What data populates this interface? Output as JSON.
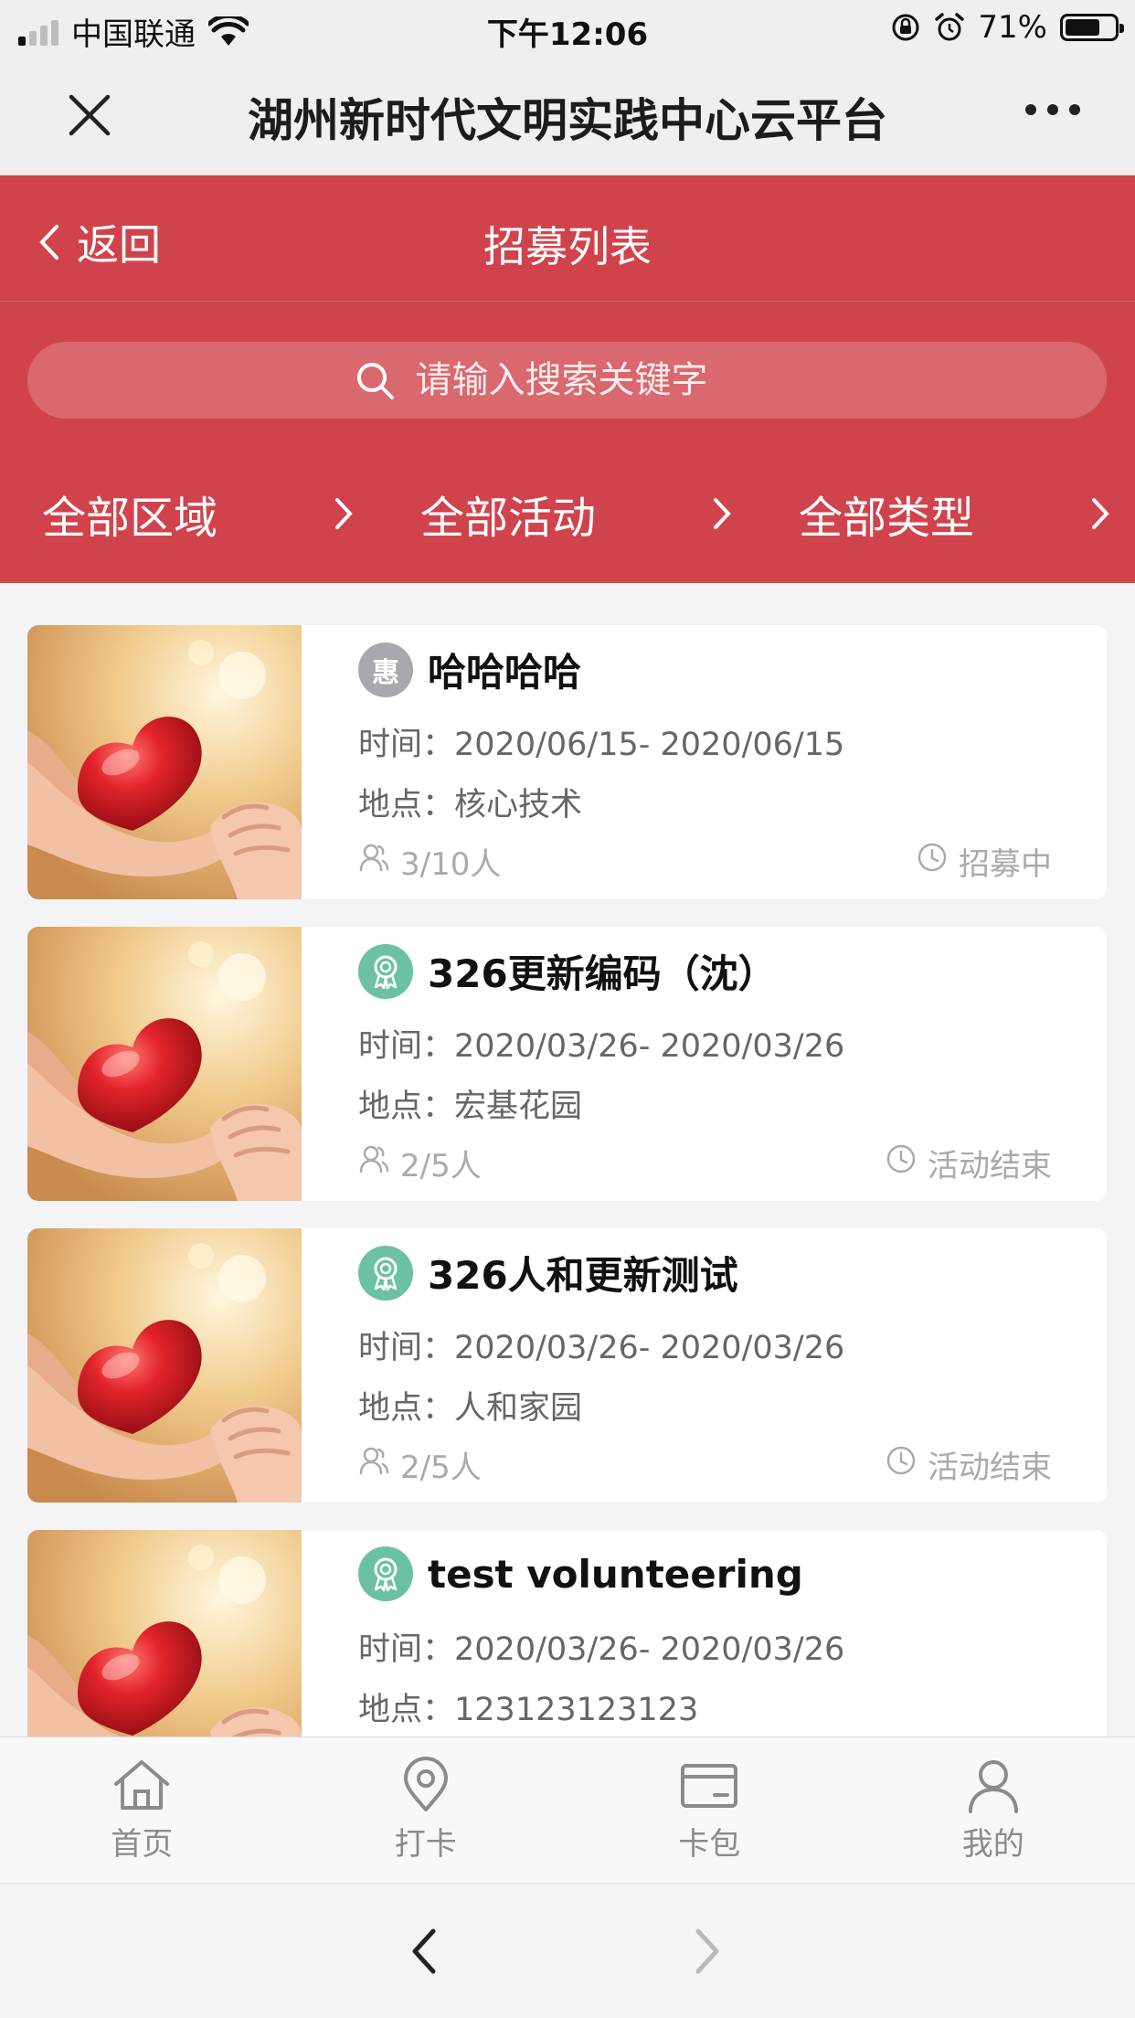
{
  "status_bar": {
    "carrier": "中国联通",
    "time": "下午12:06",
    "battery": "71%",
    "battery_level": 0.71
  },
  "title_bar": {
    "title": "湖州新时代文明实践中心云平台"
  },
  "header": {
    "back_label": "返回",
    "title": "招募列表"
  },
  "search": {
    "placeholder": "请输入搜索关键字"
  },
  "filters": [
    {
      "label": "全部区域"
    },
    {
      "label": "全部活动"
    },
    {
      "label": "全部类型"
    }
  ],
  "items": [
    {
      "badge": "惠",
      "badge_style": "gray",
      "title": "哈哈哈哈",
      "time_label": "时间：",
      "time": "2020/06/15- 2020/06/15",
      "place_label": "地点：",
      "place": "核心技术",
      "count": "3/10人",
      "status": "招募中"
    },
    {
      "badge": "",
      "badge_style": "green",
      "title": "326更新编码（沈）",
      "time_label": "时间：",
      "time": "2020/03/26- 2020/03/26",
      "place_label": "地点：",
      "place": "宏基花园",
      "count": "2/5人",
      "status": "活动结束"
    },
    {
      "badge": "",
      "badge_style": "green",
      "title": "326人和更新测试",
      "time_label": "时间：",
      "time": "2020/03/26- 2020/03/26",
      "place_label": "地点：",
      "place": "人和家园",
      "count": "2/5人",
      "status": "活动结束"
    },
    {
      "badge": "",
      "badge_style": "green",
      "title": "test volunteering",
      "time_label": "时间：",
      "time": "2020/03/26- 2020/03/26",
      "place_label": "地点：",
      "place": "123123123123",
      "count": "",
      "status": ""
    }
  ],
  "tabbar": [
    {
      "label": "首页",
      "icon": "home-icon"
    },
    {
      "label": "打卡",
      "icon": "location-pin-icon"
    },
    {
      "label": "卡包",
      "icon": "wallet-icon"
    },
    {
      "label": "我的",
      "icon": "user-icon"
    }
  ],
  "colors": {
    "brand_red": "#d1434c",
    "badge_green": "#6cc0a3",
    "badge_gray": "#a7a9ae"
  }
}
